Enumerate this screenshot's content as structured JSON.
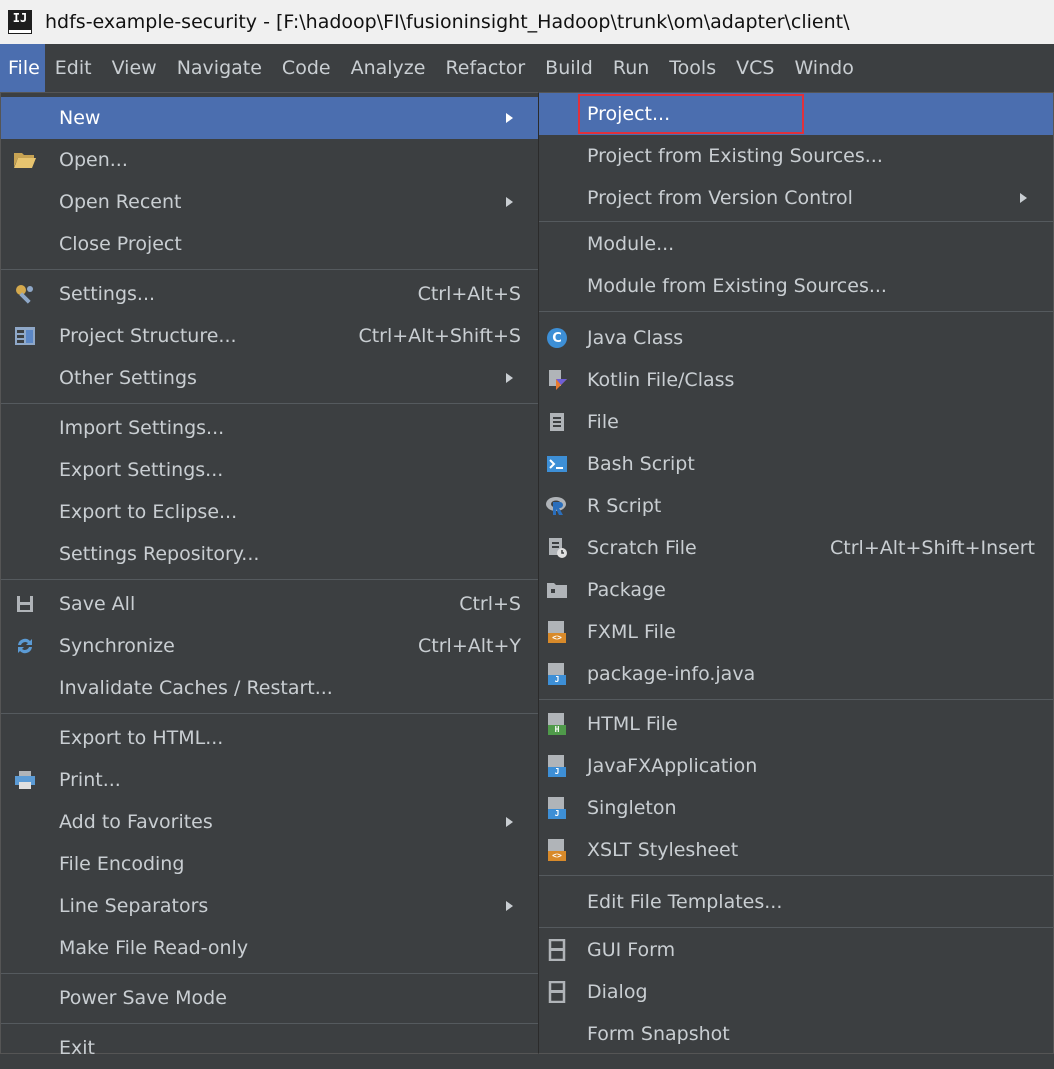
{
  "window": {
    "logo_text": "IJ",
    "title": "hdfs-example-security - [F:\\hadoop\\FI\\fusioninsight_Hadoop\\trunk\\om\\adapter\\client\\"
  },
  "menubar": [
    "File",
    "Edit",
    "View",
    "Navigate",
    "Code",
    "Analyze",
    "Refactor",
    "Build",
    "Run",
    "Tools",
    "VCS",
    "Windo"
  ],
  "file_menu": {
    "new": "New",
    "open": "Open...",
    "open_recent": "Open Recent",
    "close_project": "Close Project",
    "settings": "Settings...",
    "settings_shortcut": "Ctrl+Alt+S",
    "project_structure": "Project Structure...",
    "project_structure_shortcut": "Ctrl+Alt+Shift+S",
    "other_settings": "Other Settings",
    "import_settings": "Import Settings...",
    "export_settings": "Export Settings...",
    "export_eclipse": "Export to Eclipse...",
    "settings_repository": "Settings Repository...",
    "save_all": "Save All",
    "save_all_shortcut": "Ctrl+S",
    "synchronize": "Synchronize",
    "synchronize_shortcut": "Ctrl+Alt+Y",
    "invalidate_caches": "Invalidate Caches / Restart...",
    "export_html": "Export to HTML...",
    "print": "Print...",
    "add_favorites": "Add to Favorites",
    "file_encoding": "File Encoding",
    "line_separators": "Line Separators",
    "make_readonly": "Make File Read-only",
    "power_save": "Power Save Mode",
    "exit": "Exit"
  },
  "new_submenu": {
    "project": "Project...",
    "project_existing": "Project from Existing Sources...",
    "project_vcs": "Project from Version Control",
    "module": "Module...",
    "module_existing": "Module from Existing Sources...",
    "java_class": "Java Class",
    "kotlin": "Kotlin File/Class",
    "file": "File",
    "bash": "Bash Script",
    "r_script": "R Script",
    "scratch": "Scratch File",
    "scratch_shortcut": "Ctrl+Alt+Shift+Insert",
    "package": "Package",
    "fxml": "FXML File",
    "package_info": "package-info.java",
    "html_file": "HTML File",
    "javafx": "JavaFXApplication",
    "singleton": "Singleton",
    "xslt": "XSLT Stylesheet",
    "edit_templates": "Edit File Templates...",
    "gui_form": "GUI Form",
    "dialog": "Dialog",
    "form_snapshot": "Form Snapshot"
  },
  "colors": {
    "menu_bg": "#3c3f41",
    "selection": "#4b6eaf",
    "highlight_border": "#e0313c"
  }
}
